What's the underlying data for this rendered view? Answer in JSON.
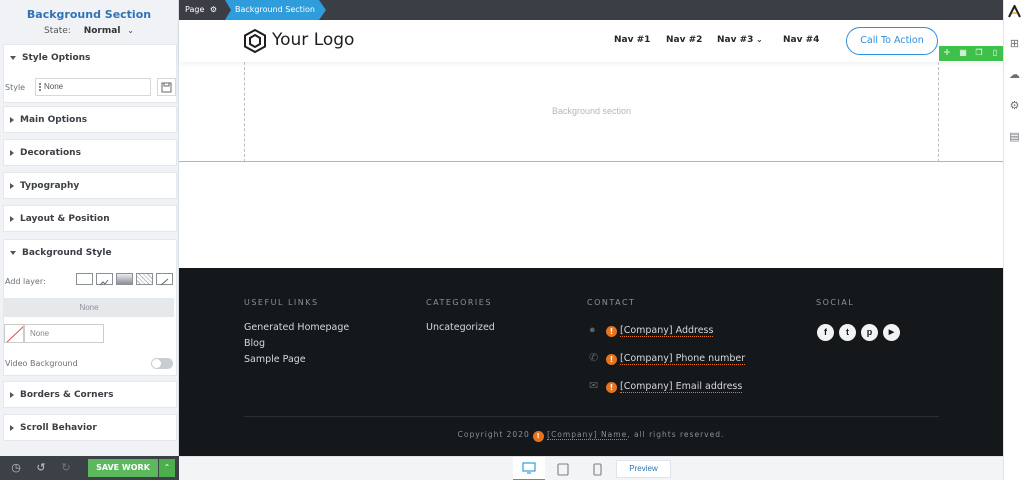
{
  "panel": {
    "title": "Background Section",
    "state_label": "State:",
    "state_value": "Normal",
    "sections": {
      "style_options": "Style Options",
      "main_options": "Main Options",
      "decorations": "Decorations",
      "typography": "Typography",
      "layout_position": "Layout & Position",
      "background_style": "Background Style",
      "borders_corners": "Borders & Corners",
      "scroll_behavior": "Scroll Behavior"
    },
    "style_label": "Style",
    "style_value": "None",
    "add_layer_label": "Add layer:",
    "layer_none": "None",
    "color_none": "None",
    "video_background_label": "Video Background",
    "save_label": "SAVE WORK"
  },
  "breadcrumb": {
    "page": "Page",
    "active": "Background Section"
  },
  "site": {
    "logo": "Your Logo",
    "nav": [
      "Nav #1",
      "Nav #2",
      "Nav #3",
      "Nav #4"
    ],
    "cta": "Call To Action",
    "bg_section_label": "Background section"
  },
  "footer": {
    "useful_links_heading": "USEFUL LINKS",
    "useful_links": [
      "Generated Homepage",
      "Blog",
      "Sample Page"
    ],
    "categories_heading": "CATEGORIES",
    "categories": [
      "Uncategorized"
    ],
    "contact_heading": "CONTACT",
    "contact": [
      "[Company] Address",
      "[Company] Phone number",
      "[Company] Email address"
    ],
    "social_heading": "SOCIAL",
    "copyright_prefix": "Copyright 2020",
    "copyright_name": "[Company] Name",
    "copyright_suffix": ", all rights reserved."
  },
  "devbar": {
    "preview": "Preview"
  },
  "colors": {
    "accent_blue": "#2f9cdc",
    "save_green": "#5cb85c",
    "footer_bg": "#14181b",
    "warning_orange": "#e8731e"
  }
}
